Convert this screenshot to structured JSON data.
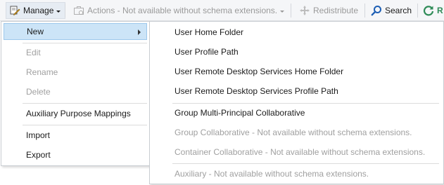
{
  "toolbar": {
    "manage_label": "Manage",
    "actions_label": "Actions - Not available without schema extensions.",
    "redistribute_label": "Redistribute",
    "search_label": "Search",
    "refresh_label": "R"
  },
  "manage_menu": {
    "items": [
      {
        "label": "New",
        "enabled": true,
        "highlighted": true,
        "submenu": true
      },
      {
        "label": "Edit",
        "enabled": false
      },
      {
        "label": "Rename",
        "enabled": false
      },
      {
        "label": "Delete",
        "enabled": false
      },
      {
        "label": "Auxiliary Purpose Mappings",
        "enabled": true
      },
      {
        "label": "Import",
        "enabled": true
      },
      {
        "label": "Export",
        "enabled": true
      }
    ]
  },
  "new_menu": {
    "items": [
      {
        "label": "User Home Folder",
        "enabled": true
      },
      {
        "label": "User Profile Path",
        "enabled": true
      },
      {
        "label": "User Remote Desktop Services Home Folder",
        "enabled": true
      },
      {
        "label": "User Remote Desktop Services Profile Path",
        "enabled": true
      },
      {
        "label": "Group Multi-Principal Collaborative",
        "enabled": true
      },
      {
        "label": "Group Collaborative - Not available without schema extensions.",
        "enabled": false
      },
      {
        "label": "Container Collaborative - Not available without schema extensions.",
        "enabled": false
      },
      {
        "label": "Auxiliary - Not available without schema extensions.",
        "enabled": false
      }
    ]
  },
  "colors": {
    "highlight_bg": "#cce4f7",
    "highlight_border": "#9dc8ec",
    "disabled_text": "#a0a0a0",
    "search_blue": "#1e5fb4",
    "refresh_green": "#2e8b57"
  }
}
